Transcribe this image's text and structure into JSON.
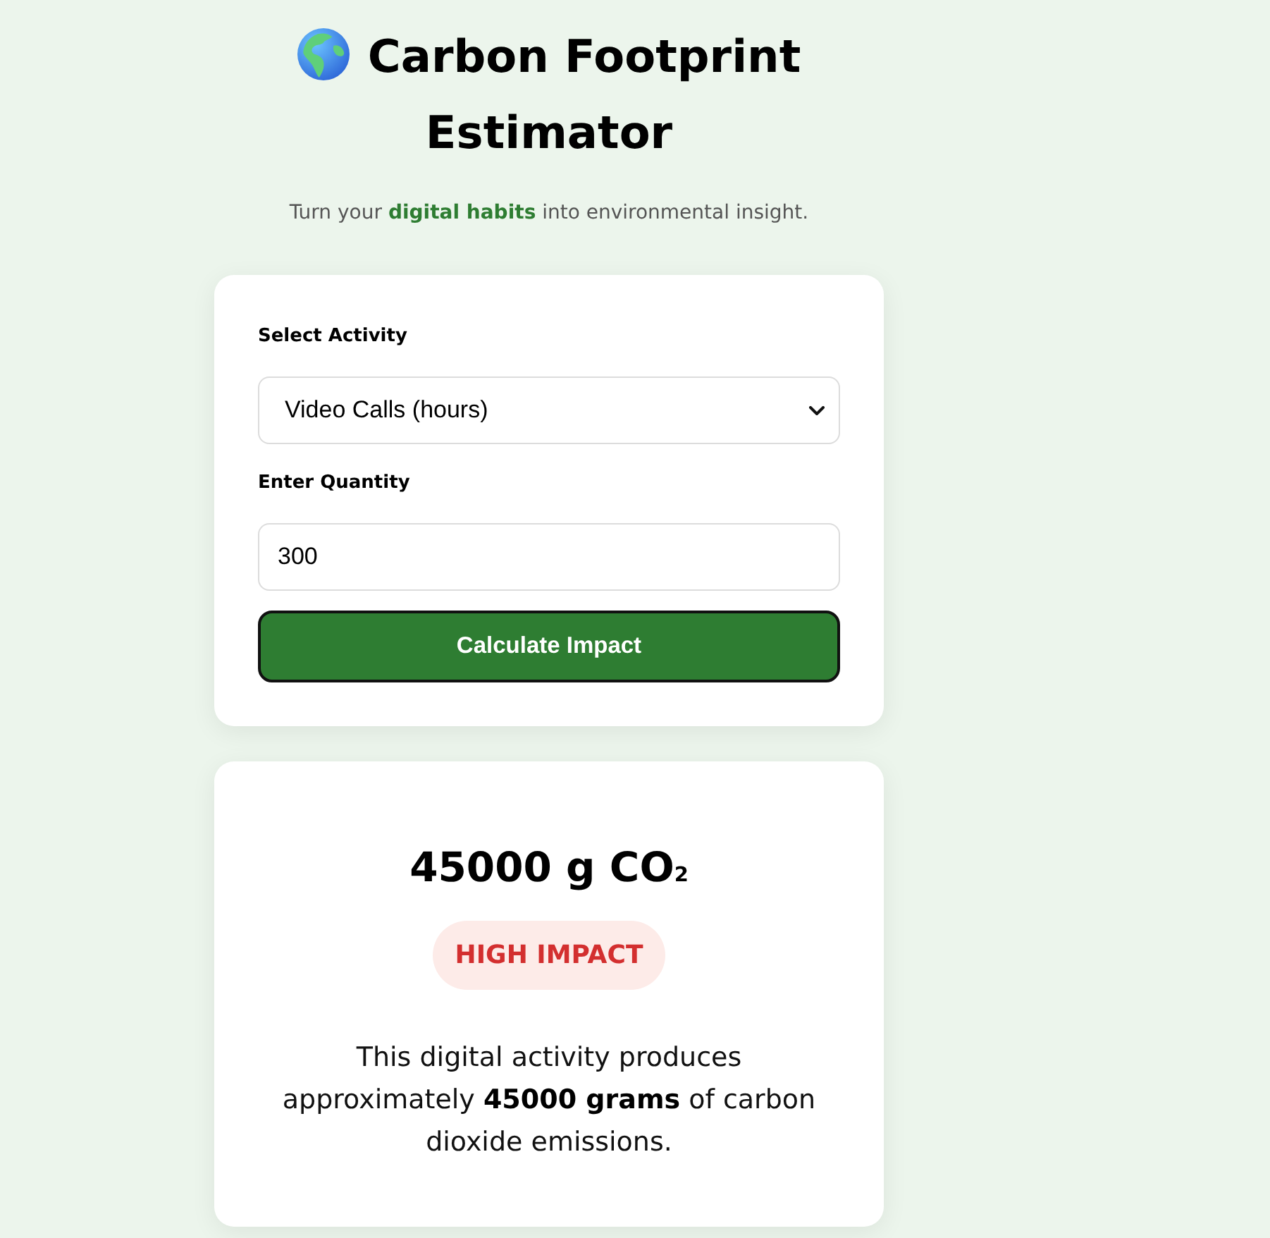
{
  "header": {
    "title": "Carbon Footprint Estimator",
    "subtitle": "Turn your **digital habits** into environmental insight."
  },
  "form": {
    "activity_label": "Select Activity",
    "activity_value": "Video Calls (hours)",
    "quantity_label": "Enter Quantity",
    "quantity_value": "300",
    "submit_button": "Calculate Impact"
  },
  "result": {
    "amount": "45000 g CO$_{2}$",
    "impact_label": "HIGH IMPACT",
    "description": "This digital activity produces approximately **45000 grams** of carbon dioxide emissions."
  }
}
